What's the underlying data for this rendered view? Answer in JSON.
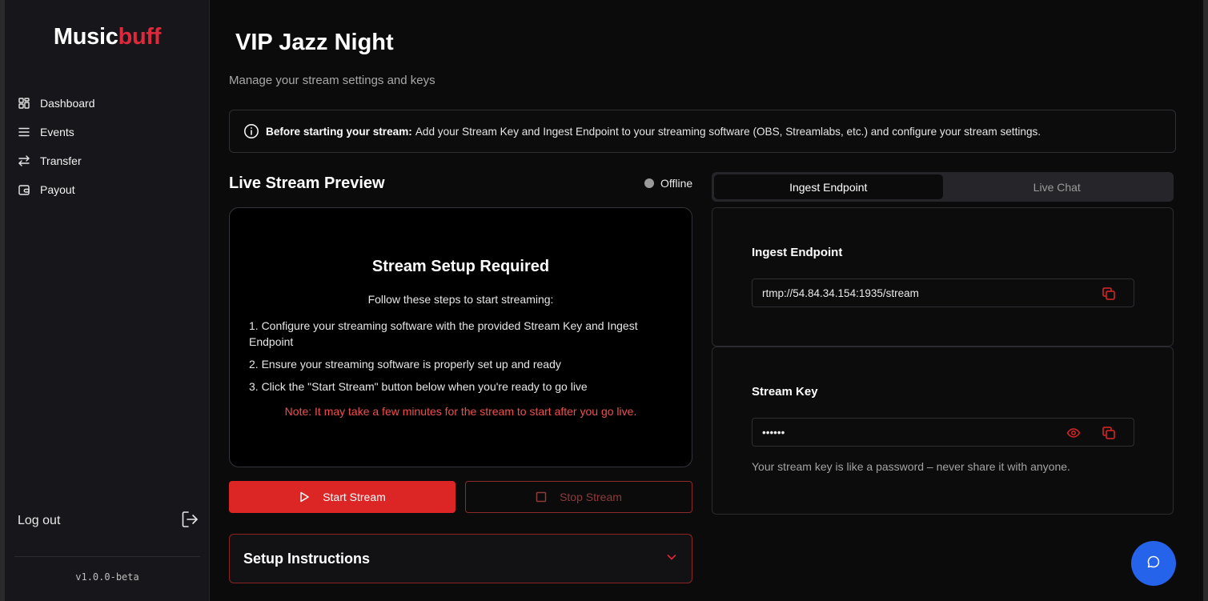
{
  "sidebar": {
    "brand_part1": "Music",
    "brand_part2": "buff",
    "items": [
      {
        "label": "Dashboard",
        "icon": "grid-icon"
      },
      {
        "label": "Events",
        "icon": "menu-lines-icon"
      },
      {
        "label": "Transfer",
        "icon": "arrows-swap-icon"
      },
      {
        "label": "Payout",
        "icon": "wallet-icon"
      }
    ],
    "logout_label": "Log out",
    "version": "v1.0.0-beta"
  },
  "header": {
    "title": "VIP Jazz Night",
    "subtitle": "Manage your stream settings and keys"
  },
  "notice": {
    "bold": "Before starting your stream:",
    "text": "Add your Stream Key and Ingest Endpoint to your streaming software (OBS, Streamlabs, etc.) and configure your stream settings."
  },
  "preview": {
    "title": "Live Stream Preview",
    "status": "Offline",
    "setup_heading": "Stream Setup Required",
    "setup_sub": "Follow these steps to start streaming:",
    "steps": [
      "1. Configure your streaming software with the provided Stream Key and Ingest Endpoint",
      "2. Ensure your streaming software is properly set up and ready",
      "3. Click the \"Start Stream\" button below when you're ready to go live"
    ],
    "note": "Note: It may take a few minutes for the stream to start after you go live."
  },
  "actions": {
    "start_label": "Start Stream",
    "stop_label": "Stop Stream"
  },
  "accordion": {
    "title": "Setup Instructions"
  },
  "tabs": [
    {
      "label": "Ingest Endpoint",
      "active": true
    },
    {
      "label": "Live Chat",
      "active": false
    }
  ],
  "ingest": {
    "heading": "Ingest Endpoint",
    "value": "rtmp://54.84.34.154:1935/stream"
  },
  "stream_key": {
    "heading": "Stream Key",
    "value": "••••••",
    "helper": "Your stream key is like a password – never share it with anyone."
  },
  "colors": {
    "accent": "#dc2626",
    "brand_accent": "#e0283a",
    "fab": "#2563eb"
  }
}
